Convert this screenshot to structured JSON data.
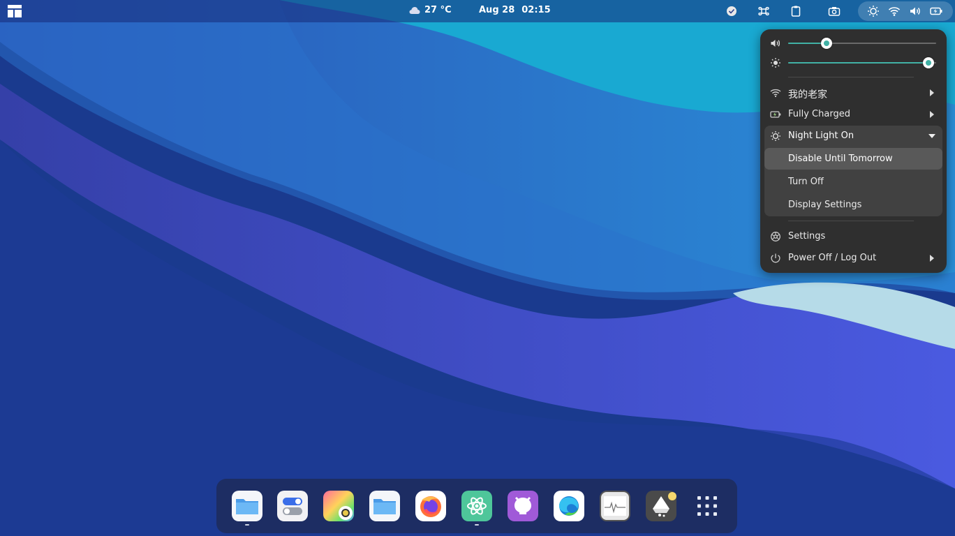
{
  "topbar": {
    "weather_temp": "27 °C",
    "date": "Aug 28",
    "time": "02:15"
  },
  "quick_menu": {
    "volume_level": 0.26,
    "brightness_level": 0.95,
    "wifi_label": "我的老家",
    "battery_label": "Fully Charged",
    "night_light_label": "Night Light On",
    "night_light_submenu": [
      "Disable Until Tomorrow",
      "Turn Off",
      "Display Settings"
    ],
    "settings_label": "Settings",
    "power_label": "Power Off / Log Out"
  },
  "dock": {
    "apps": [
      "files",
      "settings-toggles",
      "color-picker",
      "files-2",
      "firefox",
      "atom",
      "github-desktop",
      "edge",
      "system-monitor",
      "inkscape",
      "app-grid"
    ]
  },
  "colors": {
    "accent": "#41b1a5",
    "menu_bg": "#2f2f2f"
  }
}
